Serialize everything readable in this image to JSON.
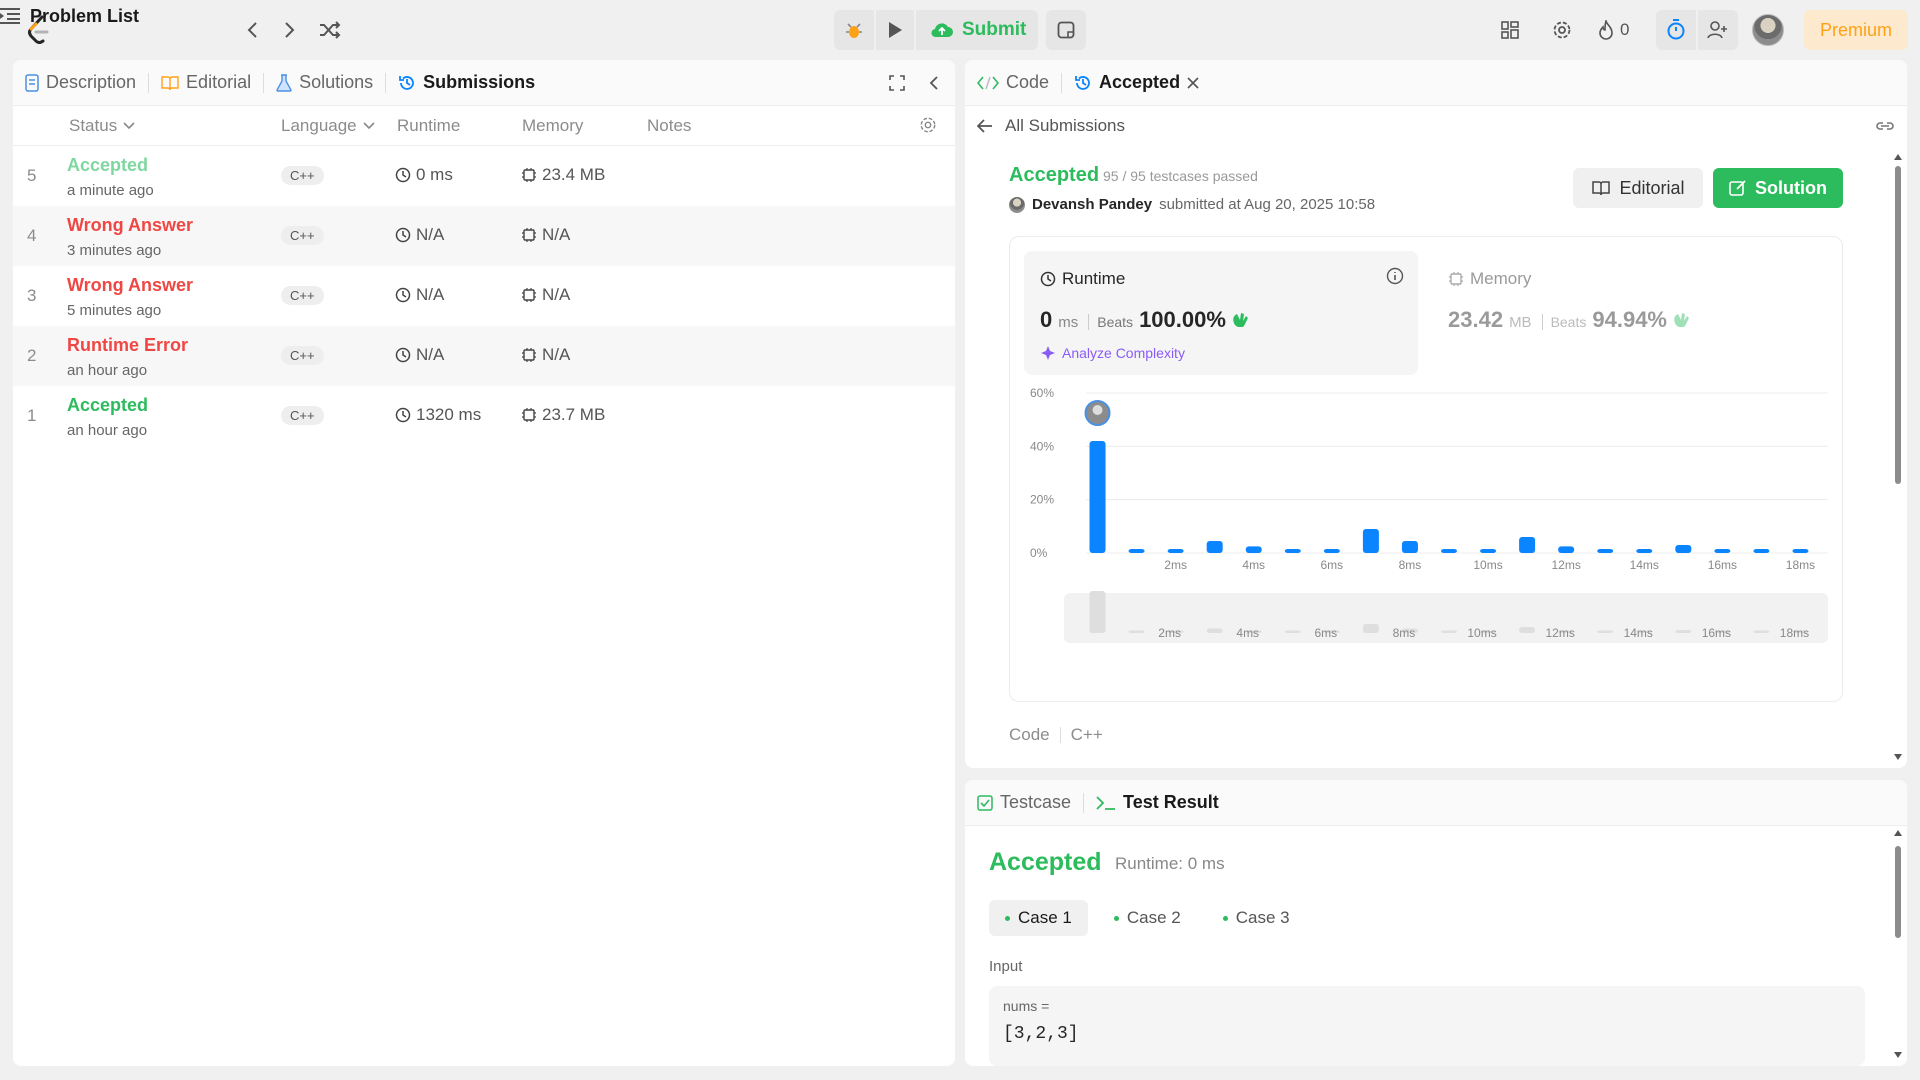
{
  "topbar": {
    "problem_list": "Problem List",
    "submit": "Submit",
    "streak_count": "0",
    "premium": "Premium"
  },
  "left": {
    "tabs": [
      {
        "label": "Description",
        "icon": "description-icon"
      },
      {
        "label": "Editorial",
        "icon": "book-icon"
      },
      {
        "label": "Solutions",
        "icon": "flask-icon"
      },
      {
        "label": "Submissions",
        "icon": "history-icon"
      }
    ],
    "columns": {
      "status": "Status",
      "language": "Language",
      "runtime": "Runtime",
      "memory": "Memory",
      "notes": "Notes"
    },
    "rows": [
      {
        "num": "5",
        "status": "Accepted",
        "time": "a minute ago",
        "lang": "C++",
        "runtime": "0 ms",
        "memory": "23.4 MB",
        "status_color": "#7fd7a0"
      },
      {
        "num": "4",
        "status": "Wrong Answer",
        "time": "3 minutes ago",
        "lang": "C++",
        "runtime": "N/A",
        "memory": "N/A",
        "status_color": "#ef4743"
      },
      {
        "num": "3",
        "status": "Wrong Answer",
        "time": "5 minutes ago",
        "lang": "C++",
        "runtime": "N/A",
        "memory": "N/A",
        "status_color": "#ef4743"
      },
      {
        "num": "2",
        "status": "Runtime Error",
        "time": "an hour ago",
        "lang": "C++",
        "runtime": "N/A",
        "memory": "N/A",
        "status_color": "#ef4743"
      },
      {
        "num": "1",
        "status": "Accepted",
        "time": "an hour ago",
        "lang": "C++",
        "runtime": "1320 ms",
        "memory": "23.7 MB",
        "status_color": "#2cbb5d"
      }
    ]
  },
  "right": {
    "tabs": {
      "code": "Code",
      "accepted": "Accepted"
    },
    "all_submissions": "All Submissions",
    "result": {
      "status": "Accepted",
      "testcases": "95 / 95 testcases passed",
      "user": "Devansh Pandey",
      "submitted_at": "submitted at Aug 20, 2025 10:58"
    },
    "buttons": {
      "editorial": "Editorial",
      "solution": "Solution"
    },
    "runtime": {
      "label": "Runtime",
      "value": "0",
      "unit": "ms",
      "beats_label": "Beats",
      "beats": "100.00%",
      "analyze": "Analyze Complexity"
    },
    "memory": {
      "label": "Memory",
      "value": "23.42",
      "unit": "MB",
      "beats_label": "Beats",
      "beats": "94.94%"
    },
    "code_label": "Code",
    "code_lang": "C++"
  },
  "bottom": {
    "tabs": {
      "testcase": "Testcase",
      "result": "Test Result"
    },
    "status": "Accepted",
    "runtime": "Runtime: 0 ms",
    "cases": [
      "Case 1",
      "Case 2",
      "Case 3"
    ],
    "input_label": "Input",
    "input_var": "nums =",
    "input_value": "[3,2,3]"
  },
  "colors": {
    "green": "#2cbb5d",
    "red": "#ef4743",
    "bar_blue": "#0a84ff",
    "premium": "#ffa116"
  },
  "chart_data": {
    "type": "bar",
    "title": "",
    "xlabel": "",
    "ylabel": "",
    "ylim": [
      0,
      60
    ],
    "y_ticks": [
      "0%",
      "20%",
      "40%",
      "60%"
    ],
    "x_tick_labels": [
      "2ms",
      "4ms",
      "6ms",
      "8ms",
      "10ms",
      "12ms",
      "14ms",
      "16ms",
      "18ms"
    ],
    "categories": [
      "0ms",
      "1ms",
      "2ms",
      "3ms",
      "4ms",
      "5ms",
      "6ms",
      "7ms",
      "8ms",
      "9ms",
      "10ms",
      "11ms",
      "12ms",
      "13ms",
      "14ms",
      "15ms",
      "16ms",
      "17ms",
      "18ms"
    ],
    "values": [
      42,
      1.5,
      1.5,
      4.5,
      2.5,
      1.5,
      1.5,
      9,
      4.5,
      1.5,
      1.5,
      6,
      2.5,
      1.5,
      1.5,
      3,
      1.5,
      1.5,
      1.5
    ],
    "highlight_index": 0,
    "grid": true
  }
}
